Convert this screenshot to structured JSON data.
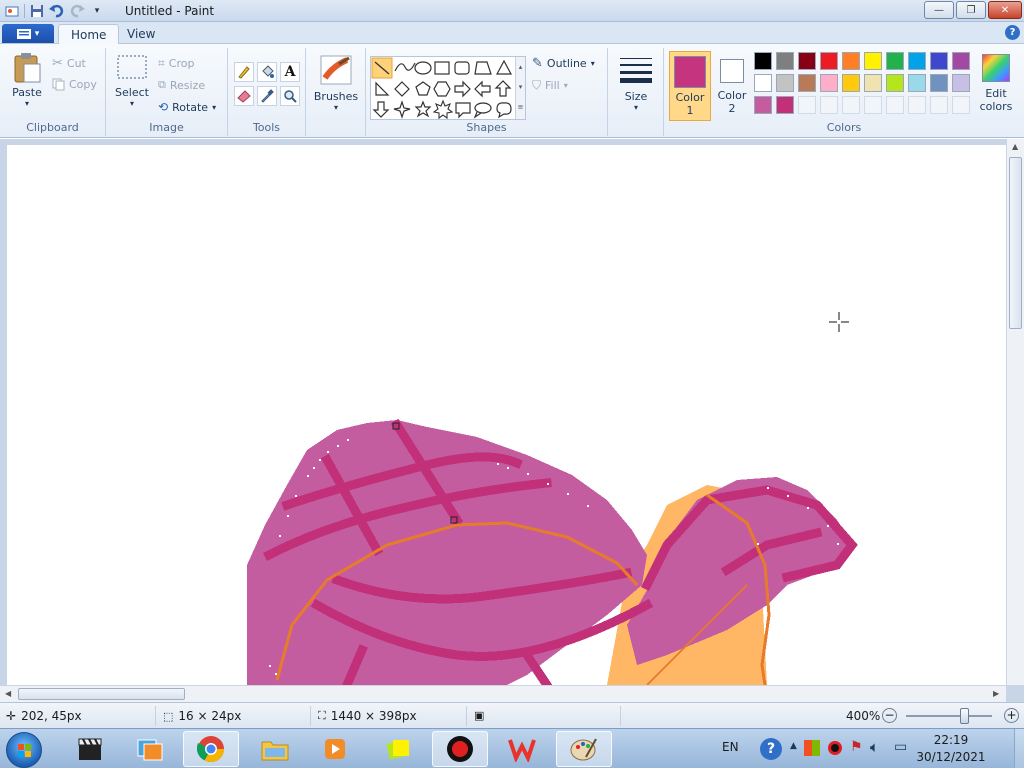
{
  "window": {
    "title": "Untitled - Paint",
    "minimize": "—",
    "maximize": "❐",
    "close": "✕"
  },
  "tabs": {
    "file": "▾",
    "home": "Home",
    "view": "View"
  },
  "ribbon": {
    "clipboard": {
      "label": "Clipboard",
      "paste": "Paste",
      "cut": "Cut",
      "copy": "Copy"
    },
    "image": {
      "label": "Image",
      "select": "Select",
      "crop": "Crop",
      "resize": "Resize",
      "rotate": "Rotate"
    },
    "tools": {
      "label": "Tools"
    },
    "brushes": {
      "label": "Brushes"
    },
    "shapes": {
      "label": "Shapes",
      "outline": "Outline",
      "fill": "Fill"
    },
    "size": {
      "label": "Size"
    },
    "colors": {
      "label": "Colors",
      "color1_label_a": "Color",
      "color1_label_b": "1",
      "color2_label_a": "Color",
      "color2_label_b": "2",
      "edit_a": "Edit",
      "edit_b": "colors",
      "color1": "#c5357f",
      "color2": "#ffffff",
      "palette_row1": [
        "#000000",
        "#7f7f7f",
        "#880015",
        "#ed1c24",
        "#ff7f27",
        "#fff200",
        "#22b14c",
        "#00a2e8",
        "#3f48cc",
        "#a349a4"
      ],
      "palette_row2": [
        "#ffffff",
        "#c3c3c3",
        "#b97a57",
        "#ffaec9",
        "#ffc90e",
        "#efe4b0",
        "#b5e61d",
        "#99d9ea",
        "#7092be",
        "#c8bfe7"
      ],
      "palette_row3": [
        "#c45ca0",
        "#c2307a",
        "",
        "",
        "",
        "",
        "",
        "",
        "",
        ""
      ]
    }
  },
  "status": {
    "cursor_pos": "202, 45px",
    "selection_size": "16 × 24px",
    "image_size": "1440 × 398px",
    "zoom": "400%"
  },
  "taskbar": {
    "language": "EN",
    "time": "22:19",
    "date": "30/12/2021"
  }
}
